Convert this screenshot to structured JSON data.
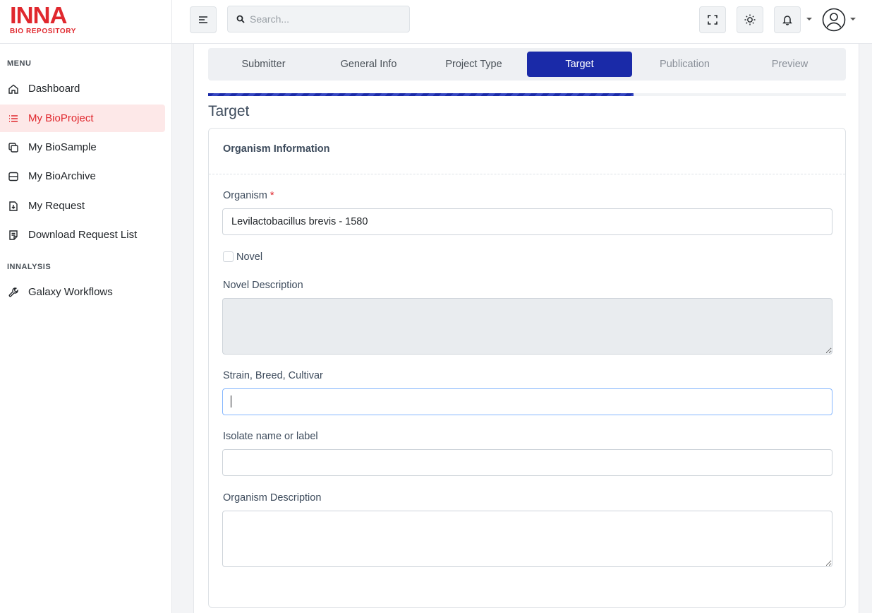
{
  "brand": {
    "name": "INNA",
    "subtitle": "BIO REPOSITORY",
    "color": "#e0282e"
  },
  "sidebar": {
    "sections": [
      {
        "label": "MENU"
      },
      {
        "label": "INNALYSIS"
      }
    ],
    "items": [
      {
        "label": "Dashboard",
        "icon": "home-icon"
      },
      {
        "label": "My BioProject",
        "icon": "list-icon",
        "active": true
      },
      {
        "label": "My BioSample",
        "icon": "copy-icon"
      },
      {
        "label": "My BioArchive",
        "icon": "server-icon"
      },
      {
        "label": "My Request",
        "icon": "file-download-icon"
      },
      {
        "label": "Download Request List",
        "icon": "file-list-icon"
      },
      {
        "label": "Galaxy Workflows",
        "icon": "wrench-icon"
      }
    ]
  },
  "header": {
    "search_placeholder": "Search...",
    "icons": [
      "menu-toggle-icon",
      "search-icon",
      "fullscreen-icon",
      "sun-icon",
      "bell-icon",
      "user-avatar-icon"
    ]
  },
  "wizard": {
    "steps": [
      "Submitter",
      "General Info",
      "Project Type",
      "Target",
      "Publication",
      "Preview"
    ],
    "active_step": "Target",
    "progress_fraction": 0.667,
    "accent_color": "#1a2aa8"
  },
  "page_title": "Target",
  "card": {
    "title": "Organism Information",
    "organism_label": "Organism",
    "organism_required_mark": "*",
    "organism_value": "Levilactobacillus brevis - 1580",
    "novel_label": "Novel",
    "novel_checked": false,
    "novel_description_label": "Novel Description",
    "strain_label": "Strain, Breed, Cultivar",
    "strain_value": "",
    "isolate_label": "Isolate name or label",
    "isolate_value": "",
    "organism_description_label": "Organism Description"
  }
}
